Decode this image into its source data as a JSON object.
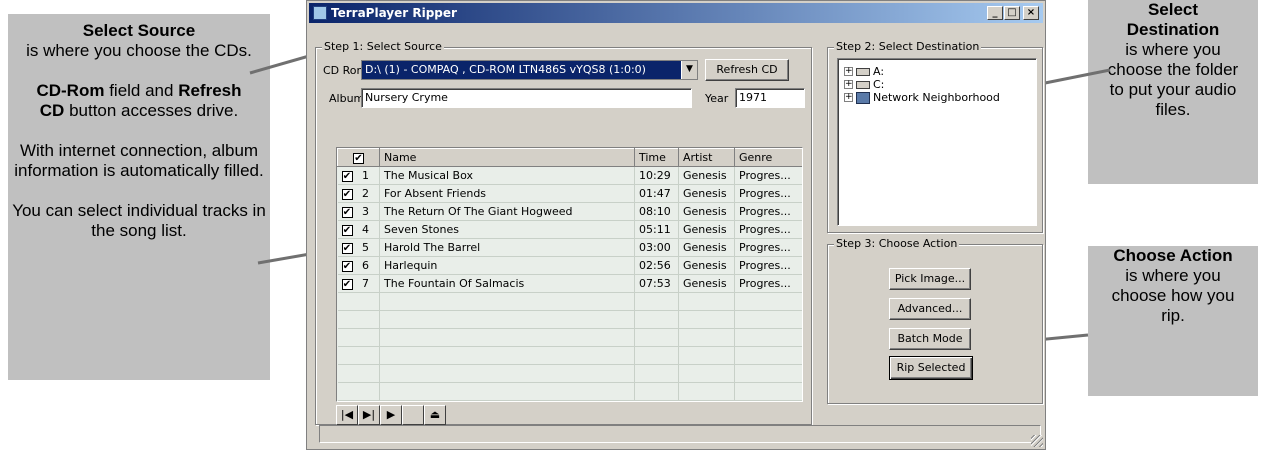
{
  "callouts": {
    "select_source": {
      "title": "Select Source",
      "line1": "is where you choose the CDs.",
      "p2_bold1": "CD-Rom",
      "p2_text1": " field and ",
      "p2_bold2": "Refresh CD",
      "p2_text2": " button accesses drive.",
      "p3": "With internet connection, album information is automatically filled.",
      "p4": "You can select individual tracks in the song list."
    },
    "select_destination": {
      "title": "Select Destination",
      "text": "is where you choose the folder to put your audio files."
    },
    "choose_action": {
      "title": "Choose Action",
      "text": "is where you choose how you rip."
    }
  },
  "window": {
    "title": "TerraPlayer Ripper",
    "min_btn": "_",
    "max_btn": "□",
    "close_btn": "×"
  },
  "step1": {
    "label": "Step 1: Select Source",
    "cdrom_label": "CD Rom",
    "cdrom_value": "D:\\ (1) - COMPAQ   , CD-ROM LTN486S   vYQS8 (1:0:0)",
    "refresh_label": "Refresh CD",
    "album_label": "Album",
    "album_value": "Nursery Cryme",
    "year_label": "Year",
    "year_value": "1971"
  },
  "tracklist": {
    "columns": [
      "Name",
      "Time",
      "Artist",
      "Genre"
    ],
    "header_check": "✔",
    "tracks": [
      {
        "num": "1",
        "name": "The Musical Box",
        "time": "10:29",
        "artist": "Genesis",
        "genre": "Progres..."
      },
      {
        "num": "2",
        "name": "For Absent Friends",
        "time": "01:47",
        "artist": "Genesis",
        "genre": "Progres..."
      },
      {
        "num": "3",
        "name": "The Return Of The Giant Hogweed",
        "time": "08:10",
        "artist": "Genesis",
        "genre": "Progres..."
      },
      {
        "num": "4",
        "name": "Seven Stones",
        "time": "05:11",
        "artist": "Genesis",
        "genre": "Progres..."
      },
      {
        "num": "5",
        "name": "Harold The Barrel",
        "time": "03:00",
        "artist": "Genesis",
        "genre": "Progres..."
      },
      {
        "num": "6",
        "name": "Harlequin",
        "time": "02:56",
        "artist": "Genesis",
        "genre": "Progres..."
      },
      {
        "num": "7",
        "name": "The Fountain Of Salmacis",
        "time": "07:53",
        "artist": "Genesis",
        "genre": "Progres..."
      }
    ],
    "check_mark": "✔"
  },
  "player_controls": [
    {
      "name": "previous-track-button",
      "glyph": "|◀"
    },
    {
      "name": "next-track-button",
      "glyph": "▶|"
    },
    {
      "name": "play-button",
      "glyph": "▶"
    },
    {
      "name": "stop-button",
      "glyph": ""
    },
    {
      "name": "eject-button",
      "glyph": "⏏"
    }
  ],
  "step2": {
    "label": "Step 2: Select Destination",
    "tree": [
      {
        "label": "A:",
        "icon": "drive-icon"
      },
      {
        "label": "C:",
        "icon": "drive-icon"
      },
      {
        "label": "Network Neighborhood",
        "icon": "network-icon"
      }
    ],
    "expander": "+"
  },
  "step3": {
    "label": "Step 3: Choose Action",
    "pick_image": "Pick Image...",
    "advanced": "Advanced...",
    "batch_mode": "Batch Mode",
    "rip_selected": "Rip Selected"
  }
}
